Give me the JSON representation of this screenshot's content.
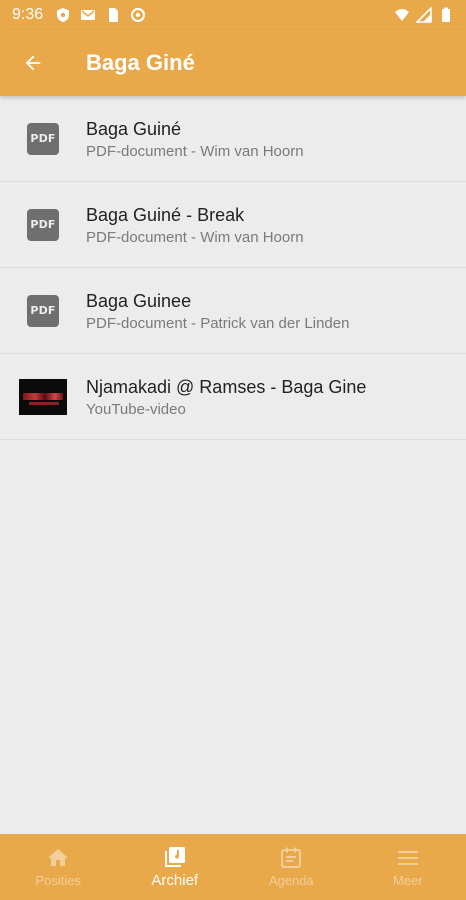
{
  "status_bar": {
    "time": "9:36"
  },
  "app_bar": {
    "title": "Baga Giné"
  },
  "items": [
    {
      "type": "pdf",
      "icon_text": "PDF",
      "title": "Baga Guiné",
      "subtitle": "PDF-document - Wim van Hoorn"
    },
    {
      "type": "pdf",
      "icon_text": "PDF",
      "title": "Baga Guiné - Break",
      "subtitle": "PDF-document - Wim van Hoorn"
    },
    {
      "type": "pdf",
      "icon_text": "PDF",
      "title": "Baga Guinee",
      "subtitle": "PDF-document - Patrick van der Linden"
    },
    {
      "type": "youtube",
      "title": "Njamakadi @ Ramses - Baga Gine",
      "subtitle": "YouTube-video"
    }
  ],
  "bottom_nav": {
    "items": [
      {
        "label": "Posities",
        "icon": "home-icon",
        "active": false
      },
      {
        "label": "Archief",
        "icon": "archive-icon",
        "active": true
      },
      {
        "label": "Agenda",
        "icon": "calendar-icon",
        "active": false
      },
      {
        "label": "Meer",
        "icon": "menu-icon",
        "active": false
      }
    ]
  },
  "colors": {
    "primary": "#e9a84a",
    "background": "#ececec",
    "inactive_nav": "#f2cf9a"
  }
}
